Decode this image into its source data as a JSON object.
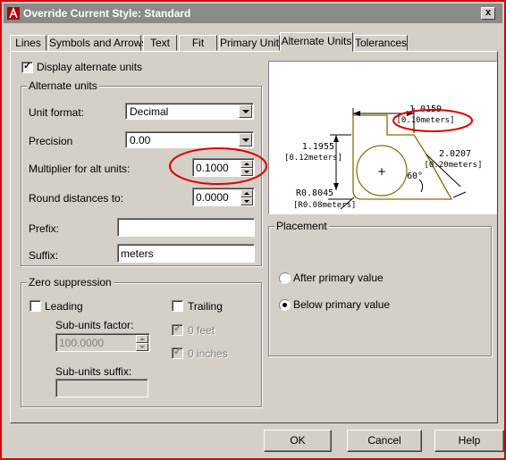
{
  "window": {
    "title": "Override Current Style: Standard",
    "close_glyph": "x"
  },
  "tabs": [
    {
      "label": "Lines"
    },
    {
      "label": "Symbols and Arrows"
    },
    {
      "label": "Text"
    },
    {
      "label": "Fit"
    },
    {
      "label": "Primary Units"
    },
    {
      "label": "Alternate Units",
      "active": true
    },
    {
      "label": "Tolerances"
    }
  ],
  "display_alternate_units": {
    "label": "Display alternate units",
    "checked": true
  },
  "alternate_units": {
    "group_label": "Alternate units",
    "unit_format": {
      "label": "Unit format:",
      "value": "Decimal"
    },
    "precision": {
      "label": "Precision",
      "value": "0.00"
    },
    "multiplier": {
      "label": "Multiplier for alt units:",
      "value": "0.1000"
    },
    "round_distances": {
      "label": "Round distances  to:",
      "value": "0.0000"
    },
    "prefix": {
      "label": "Prefix:",
      "value": ""
    },
    "suffix": {
      "label": "Suffix:",
      "value": "meters"
    }
  },
  "zero_suppression": {
    "group_label": "Zero suppression",
    "leading": {
      "label": "Leading",
      "checked": false
    },
    "trailing": {
      "label": "Trailing",
      "checked": false
    },
    "sub_units_factor": {
      "label": "Sub-units factor:",
      "value": "100.0000"
    },
    "sub_units_suffix": {
      "label": "Sub-units suffix:",
      "value": ""
    },
    "zero_feet": {
      "label": "0 feet",
      "checked": true,
      "disabled": true
    },
    "zero_inches": {
      "label": "0 inches",
      "checked": true,
      "disabled": true
    }
  },
  "preview": {
    "dim_top": "1.0159",
    "dim_top_alt": "[0.10meters]",
    "dim_left": "1.1955",
    "dim_left_alt": "[0.12meters]",
    "dim_right": "2.0207",
    "dim_right_alt": "[0.20meters]",
    "angle": "60°",
    "radius": "R0.8045",
    "radius_alt": "[R0.08meters]",
    "center_mark": "+"
  },
  "placement": {
    "group_label": "Placement",
    "options": [
      {
        "label": "After primary value",
        "selected": false
      },
      {
        "label": "Below primary value",
        "selected": true
      }
    ]
  },
  "buttons": {
    "ok": "OK",
    "cancel": "Cancel",
    "help": "Help"
  },
  "colors": {
    "annotation_circle": "#e00000",
    "dialog_border": "#d80000",
    "preview_outline": "#8b6b00"
  }
}
